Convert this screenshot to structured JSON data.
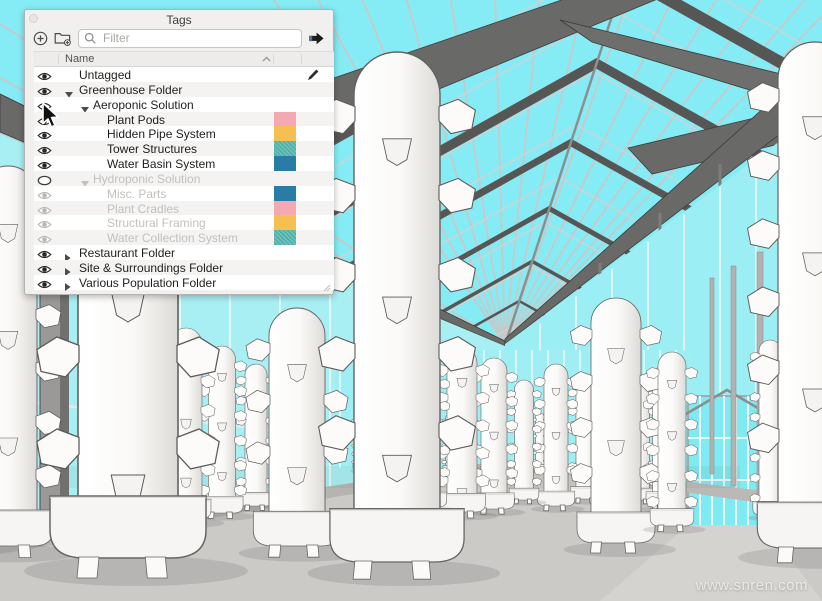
{
  "window": {
    "watermark": "www.snren.com"
  },
  "scene": {
    "viewport_name": "greenhouse-3d-model",
    "sky_color": "#85ecf5"
  },
  "tags_panel": {
    "title": "Tags",
    "toolbar": {
      "add_tag_icon": "circle-plus-icon",
      "add_folder_icon": "folder-plus-icon",
      "filter_placeholder": "Filter",
      "details_icon": "details-arrow-icon"
    },
    "header": {
      "name_label": "Name",
      "sort_icon": "chevron-up"
    },
    "colors": {
      "pink": "#f3a8b2",
      "yellow": "#f6bf52",
      "teal": "#4fb1a9",
      "blue": "#2b7ba7"
    },
    "rows": [
      {
        "label": "Untagged",
        "level": 0,
        "eye": "visible",
        "arrow": "none",
        "swatch": null,
        "textured": false,
        "dimmed": false,
        "pencil": true,
        "cursor": false
      },
      {
        "label": "Greenhouse Folder",
        "level": 0,
        "eye": "visible",
        "arrow": "down",
        "swatch": null,
        "textured": false,
        "dimmed": false,
        "pencil": false,
        "cursor": false
      },
      {
        "label": "Aeroponic Solution",
        "level": 1,
        "eye": "visible",
        "arrow": "down",
        "swatch": null,
        "textured": false,
        "dimmed": false,
        "pencil": false,
        "cursor": true
      },
      {
        "label": "Plant Pods",
        "level": 2,
        "eye": "visible",
        "arrow": "none",
        "swatch": "#f3a8b2",
        "textured": false,
        "dimmed": false,
        "pencil": false,
        "cursor": false
      },
      {
        "label": "Hidden Pipe System",
        "level": 2,
        "eye": "visible",
        "arrow": "none",
        "swatch": "#f6bf52",
        "textured": false,
        "dimmed": false,
        "pencil": false,
        "cursor": false
      },
      {
        "label": "Tower Structures",
        "level": 2,
        "eye": "visible",
        "arrow": "none",
        "swatch": "#4fb1a9",
        "textured": true,
        "dimmed": false,
        "pencil": false,
        "cursor": false
      },
      {
        "label": "Water Basin System",
        "level": 2,
        "eye": "visible",
        "arrow": "none",
        "swatch": "#2b7ba7",
        "textured": false,
        "dimmed": false,
        "pencil": false,
        "cursor": false
      },
      {
        "label": "Hydroponic Solution",
        "level": 1,
        "eye": "folder-hidden",
        "arrow": "down",
        "swatch": null,
        "textured": false,
        "dimmed": true,
        "pencil": false,
        "cursor": false
      },
      {
        "label": "Misc. Parts",
        "level": 2,
        "eye": "visible",
        "arrow": "none",
        "swatch": "#2b7ba7",
        "textured": false,
        "dimmed": true,
        "pencil": false,
        "cursor": false
      },
      {
        "label": "Plant Cradles",
        "level": 2,
        "eye": "visible",
        "arrow": "none",
        "swatch": "#f3a8b2",
        "textured": false,
        "dimmed": true,
        "pencil": false,
        "cursor": false
      },
      {
        "label": "Structural Framing",
        "level": 2,
        "eye": "visible",
        "arrow": "none",
        "swatch": "#f6bf52",
        "textured": false,
        "dimmed": true,
        "pencil": false,
        "cursor": false
      },
      {
        "label": "Water Collection System",
        "level": 2,
        "eye": "visible",
        "arrow": "none",
        "swatch": "#4fb1a9",
        "textured": true,
        "dimmed": true,
        "pencil": false,
        "cursor": false
      },
      {
        "label": "Restaurant Folder",
        "level": 0,
        "eye": "visible",
        "arrow": "right",
        "swatch": null,
        "textured": false,
        "dimmed": false,
        "pencil": false,
        "cursor": false
      },
      {
        "label": "Site & Surroundings Folder",
        "level": 0,
        "eye": "visible",
        "arrow": "right",
        "swatch": null,
        "textured": false,
        "dimmed": false,
        "pencil": false,
        "cursor": false
      },
      {
        "label": "Various Population Folder",
        "level": 0,
        "eye": "visible",
        "arrow": "right",
        "swatch": null,
        "textured": false,
        "dimmed": false,
        "pencil": false,
        "cursor": false
      }
    ]
  }
}
